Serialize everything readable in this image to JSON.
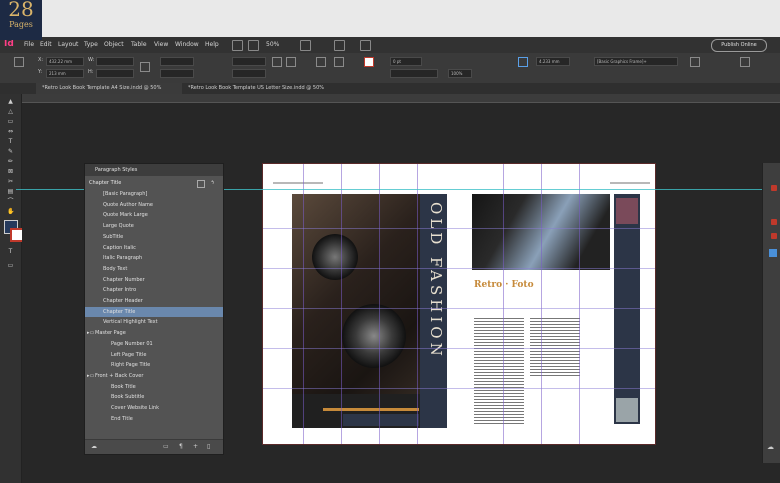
{
  "badge": {
    "number": "28",
    "label": "Pages"
  },
  "app": {
    "icon_label": "Id"
  },
  "menu": {
    "items": [
      "File",
      "Edit",
      "Layout",
      "Type",
      "Object",
      "Table",
      "View",
      "Window",
      "Help"
    ],
    "zoom": "50%",
    "publish": "Publish Online"
  },
  "control": {
    "x_label": "X:",
    "x_value": "432.22 mm",
    "y_label": "Y:",
    "y_value": "213 mm",
    "w_label": "W:",
    "h_label": "H:",
    "stroke_value": "0 pt",
    "opacity_value": "100%",
    "dim_value": "4.233 mm",
    "frame_style": "[Basic Graphics Frame]+"
  },
  "tabs": [
    "*Retro Look Book Template A4 Size.indd @ 50%",
    "*Retro Look Book Template US Letter Size.indd @ 50%"
  ],
  "panel": {
    "title": "Paragraph Styles",
    "current": "Chapter Title",
    "items": [
      {
        "label": "[Basic Paragraph]",
        "indent": 18
      },
      {
        "label": "Quote Author Name",
        "indent": 18
      },
      {
        "label": "Quote Mark Large",
        "indent": 18
      },
      {
        "label": "Large Quote",
        "indent": 18
      },
      {
        "label": "SubTitle",
        "indent": 18
      },
      {
        "label": "Caption Italic",
        "indent": 18
      },
      {
        "label": "Italic Paragraph",
        "indent": 18
      },
      {
        "label": "Body Text",
        "indent": 18
      },
      {
        "label": "Chapter Number",
        "indent": 18
      },
      {
        "label": "Chapter Intro",
        "indent": 18
      },
      {
        "label": "Chapter Header",
        "indent": 18
      },
      {
        "label": "Chapter Title",
        "indent": 18,
        "selected": true
      },
      {
        "label": "Vertical Highlight Text",
        "indent": 18
      },
      {
        "label": "Master Page",
        "indent": 10,
        "group": true
      },
      {
        "label": "Page Number 01",
        "indent": 26
      },
      {
        "label": "Left Page Title",
        "indent": 26
      },
      {
        "label": "Right Page Title",
        "indent": 26
      },
      {
        "label": "Front + Back Cover",
        "indent": 10,
        "group": true
      },
      {
        "label": "Book Title",
        "indent": 26
      },
      {
        "label": "Book Subtitle",
        "indent": 26
      },
      {
        "label": "Cover Website Link",
        "indent": 26
      },
      {
        "label": "End Title",
        "indent": 26
      }
    ]
  },
  "doc": {
    "vertical_title": "OLD FASHION",
    "retro_title": "Retro · Foto",
    "hash": "#"
  },
  "colors": {
    "accent": "#c68a3a",
    "selection": "#6a88ad",
    "guide": "#7a5cc9",
    "app": "#ff3f85"
  }
}
